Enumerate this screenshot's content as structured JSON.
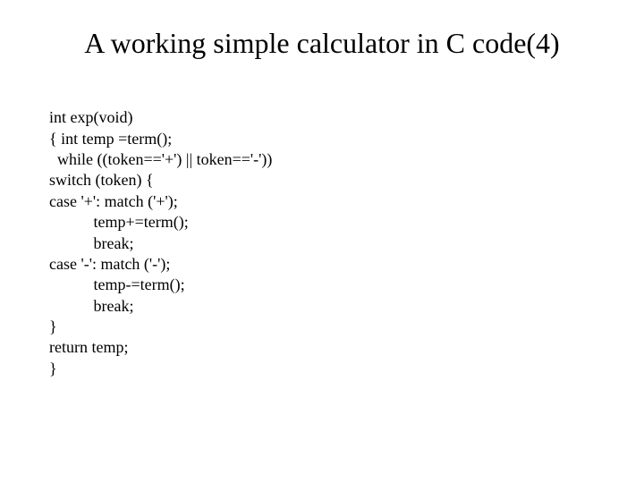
{
  "title": "A working simple calculator in C code(4)",
  "code": {
    "l1": "int exp(void)",
    "l2": "{ int temp =term();",
    "l3": "  while ((token=='+') || token=='-'))",
    "l4": "switch (token) {",
    "l5": "case '+': match ('+');",
    "l6": "           temp+=term();",
    "l7": "           break;",
    "l8": "case '-': match ('-');",
    "l9": "           temp-=term();",
    "l10": "           break;",
    "l11": "}",
    "l12": "return temp;",
    "l13": "}"
  }
}
